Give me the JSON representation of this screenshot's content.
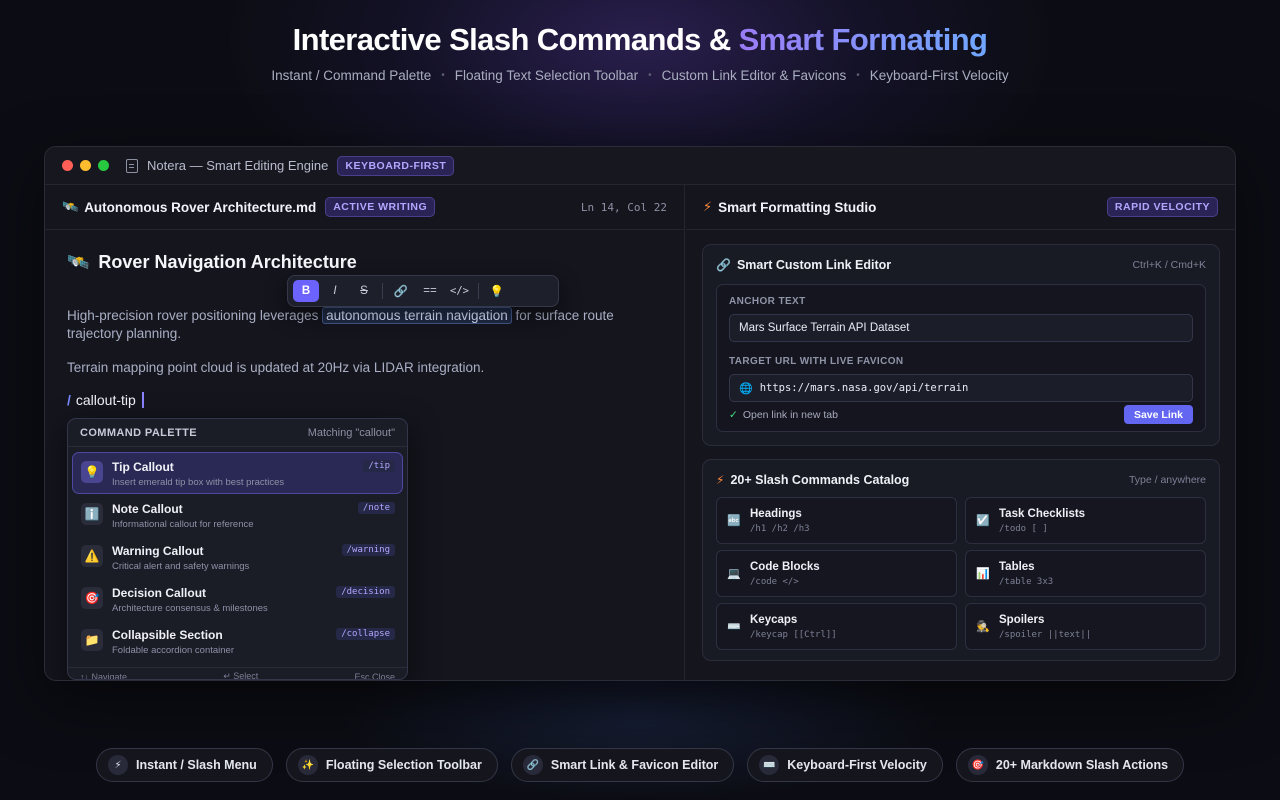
{
  "hero": {
    "title_main": "Interactive Slash Commands & ",
    "title_accent": "Smart Formatting",
    "features": [
      "Instant / Command Palette",
      "Floating Text Selection Toolbar",
      "Custom Link Editor & Favicons",
      "Keyboard-First Velocity"
    ],
    "separator": "•"
  },
  "window": {
    "title": "Notera — Smart Editing Engine",
    "badge": "KEYBOARD-FIRST"
  },
  "editor": {
    "file_icon": "🛰️",
    "file_name": "Autonomous Rover Architecture.md",
    "badge": "ACTIVE WRITING",
    "position": "Ln 14, Col 22",
    "heading_icon": "🛰️",
    "heading": "Rover Navigation Architecture",
    "para_before": "High-precision rover positioning leverages ",
    "para_highlight": "autonomous terrain navigation",
    "para_after": " for surface route trajectory planning.",
    "para2": "Terrain mapping point cloud is updated at 20Hz via LIDAR integration.",
    "slash_char": "/",
    "slash_query": "callout-tip"
  },
  "toolbar": {
    "bold": "B",
    "italic": "I",
    "strike": "S",
    "link": "🔗",
    "highlight": "==",
    "code": "</>",
    "tip": "💡"
  },
  "palette": {
    "title": "COMMAND PALETTE",
    "matching": "Matching \"callout\"",
    "items": [
      {
        "icon": "💡",
        "name": "Tip Callout",
        "desc": "Insert emerald tip box with best practices",
        "cmd": "/tip"
      },
      {
        "icon": "ℹ️",
        "name": "Note Callout",
        "desc": "Informational callout for reference",
        "cmd": "/note"
      },
      {
        "icon": "⚠️",
        "name": "Warning Callout",
        "desc": "Critical alert and safety warnings",
        "cmd": "/warning"
      },
      {
        "icon": "🎯",
        "name": "Decision Callout",
        "desc": "Architecture consensus & milestones",
        "cmd": "/decision"
      },
      {
        "icon": "📁",
        "name": "Collapsible Section",
        "desc": "Foldable accordion container",
        "cmd": "/collapse"
      }
    ],
    "footer": {
      "navigate": "↑↓ Navigate",
      "select": "↵ Select",
      "close": "Esc Close"
    }
  },
  "studio": {
    "icon": "⚡",
    "title": "Smart Formatting Studio",
    "badge": "RAPID VELOCITY"
  },
  "link_editor": {
    "title": "Smart Custom Link Editor",
    "shortcut": "Ctrl+K / Cmd+K",
    "anchor_label": "ANCHOR TEXT",
    "anchor_value": "Mars Surface Terrain API Dataset",
    "url_label": "TARGET URL WITH LIVE FAVICON",
    "url_value": "https://mars.nasa.gov/api/terrain",
    "new_tab": "Open link in new tab",
    "save": "Save Link"
  },
  "catalog": {
    "title": "20+ Slash Commands Catalog",
    "hint": "Type / anywhere",
    "items": [
      {
        "icon": "🔤",
        "name": "Headings",
        "code": "/h1 /h2 /h3"
      },
      {
        "icon": "☑️",
        "name": "Task Checklists",
        "code": "/todo [ ]"
      },
      {
        "icon": "💻",
        "name": "Code Blocks",
        "code": "/code </>"
      },
      {
        "icon": "📊",
        "name": "Tables",
        "code": "/table 3x3"
      },
      {
        "icon": "⌨️",
        "name": "Keycaps",
        "code": "/keycap [[Ctrl]]"
      },
      {
        "icon": "🕵️",
        "name": "Spoilers",
        "code": "/spoiler ||text||"
      }
    ]
  },
  "pills": [
    {
      "icon": "⚡",
      "label": "Instant / Slash Menu"
    },
    {
      "icon": "✨",
      "label": "Floating Selection Toolbar"
    },
    {
      "icon": "🔗",
      "label": "Smart Link & Favicon Editor"
    },
    {
      "icon": "⌨️",
      "label": "Keyboard-First Velocity"
    },
    {
      "icon": "🎯",
      "label": "20+ Markdown Slash Actions"
    }
  ]
}
